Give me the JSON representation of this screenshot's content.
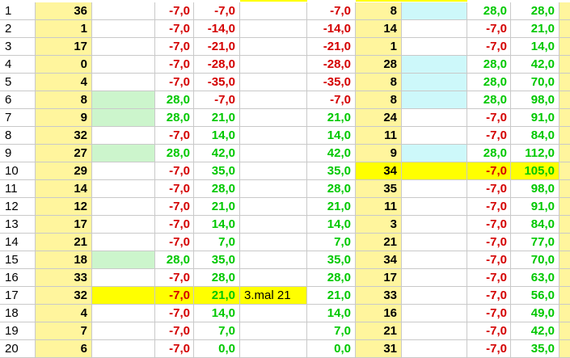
{
  "colors": {
    "negative": "#d40000",
    "positive": "#00c800",
    "column_fill": "#fff59d",
    "highlight_yellow": "#ffff00",
    "green_fill": "#ccf5cc",
    "cyan_fill": "#cdf8fa"
  },
  "rows": [
    {
      "n": "1",
      "num1": "36",
      "g1": "",
      "a": "-7,0",
      "b": "-7,0",
      "note": "",
      "c": "-7,0",
      "num2": "8",
      "g2": "cyan",
      "d": "28,0",
      "e": "28,0"
    },
    {
      "n": "2",
      "num1": "1",
      "g1": "",
      "a": "-7,0",
      "b": "-14,0",
      "note": "",
      "c": "-14,0",
      "num2": "14",
      "g2": "",
      "d": "-7,0",
      "e": "21,0"
    },
    {
      "n": "3",
      "num1": "17",
      "g1": "",
      "a": "-7,0",
      "b": "-21,0",
      "note": "",
      "c": "-21,0",
      "num2": "1",
      "g2": "",
      "d": "-7,0",
      "e": "14,0"
    },
    {
      "n": "4",
      "num1": "0",
      "g1": "",
      "a": "-7,0",
      "b": "-28,0",
      "note": "",
      "c": "-28,0",
      "num2": "28",
      "g2": "cyan",
      "d": "28,0",
      "e": "42,0"
    },
    {
      "n": "5",
      "num1": "4",
      "g1": "",
      "a": "-7,0",
      "b": "-35,0",
      "note": "",
      "c": "-35,0",
      "num2": "8",
      "g2": "cyan",
      "d": "28,0",
      "e": "70,0"
    },
    {
      "n": "6",
      "num1": "8",
      "g1": "green",
      "a": "28,0",
      "b": "-7,0",
      "note": "",
      "c": "-7,0",
      "num2": "8",
      "g2": "cyan",
      "d": "28,0",
      "e": "98,0"
    },
    {
      "n": "7",
      "num1": "9",
      "g1": "green",
      "a": "28,0",
      "b": "21,0",
      "note": "",
      "c": "21,0",
      "num2": "24",
      "g2": "",
      "d": "-7,0",
      "e": "91,0"
    },
    {
      "n": "8",
      "num1": "32",
      "g1": "",
      "a": "-7,0",
      "b": "14,0",
      "note": "",
      "c": "14,0",
      "num2": "11",
      "g2": "",
      "d": "-7,0",
      "e": "84,0"
    },
    {
      "n": "9",
      "num1": "27",
      "g1": "green",
      "a": "28,0",
      "b": "42,0",
      "note": "",
      "c": "42,0",
      "num2": "9",
      "g2": "cyan",
      "d": "28,0",
      "e": "112,0"
    },
    {
      "n": "10",
      "num1": "29",
      "g1": "",
      "a": "-7,0",
      "b": "35,0",
      "note": "",
      "c": "35,0",
      "num2": "34",
      "g2": "yellow",
      "d": "-7,0",
      "e": "105,0"
    },
    {
      "n": "11",
      "num1": "14",
      "g1": "",
      "a": "-7,0",
      "b": "28,0",
      "note": "",
      "c": "28,0",
      "num2": "35",
      "g2": "",
      "d": "-7,0",
      "e": "98,0"
    },
    {
      "n": "12",
      "num1": "12",
      "g1": "",
      "a": "-7,0",
      "b": "21,0",
      "note": "",
      "c": "21,0",
      "num2": "11",
      "g2": "",
      "d": "-7,0",
      "e": "91,0"
    },
    {
      "n": "13",
      "num1": "17",
      "g1": "",
      "a": "-7,0",
      "b": "14,0",
      "note": "",
      "c": "14,0",
      "num2": "3",
      "g2": "",
      "d": "-7,0",
      "e": "84,0"
    },
    {
      "n": "14",
      "num1": "21",
      "g1": "",
      "a": "-7,0",
      "b": "7,0",
      "note": "",
      "c": "7,0",
      "num2": "21",
      "g2": "",
      "d": "-7,0",
      "e": "77,0"
    },
    {
      "n": "15",
      "num1": "18",
      "g1": "green",
      "a": "28,0",
      "b": "35,0",
      "note": "",
      "c": "35,0",
      "num2": "34",
      "g2": "",
      "d": "-7,0",
      "e": "70,0"
    },
    {
      "n": "16",
      "num1": "33",
      "g1": "",
      "a": "-7,0",
      "b": "28,0",
      "note": "",
      "c": "28,0",
      "num2": "17",
      "g2": "",
      "d": "-7,0",
      "e": "63,0"
    },
    {
      "n": "17",
      "num1": "32",
      "g1": "yellow",
      "a": "-7,0",
      "b": "21,0",
      "note": "3.mal 21",
      "c": "21,0",
      "num2": "33",
      "g2": "",
      "d": "-7,0",
      "e": "56,0"
    },
    {
      "n": "18",
      "num1": "4",
      "g1": "",
      "a": "-7,0",
      "b": "14,0",
      "note": "",
      "c": "14,0",
      "num2": "16",
      "g2": "",
      "d": "-7,0",
      "e": "49,0"
    },
    {
      "n": "19",
      "num1": "7",
      "g1": "",
      "a": "-7,0",
      "b": "7,0",
      "note": "",
      "c": "7,0",
      "num2": "21",
      "g2": "",
      "d": "-7,0",
      "e": "42,0"
    },
    {
      "n": "20",
      "num1": "6",
      "g1": "",
      "a": "-7,0",
      "b": "0,0",
      "note": "",
      "c": "0,0",
      "num2": "31",
      "g2": "",
      "d": "-7,0",
      "e": "35,0"
    }
  ]
}
